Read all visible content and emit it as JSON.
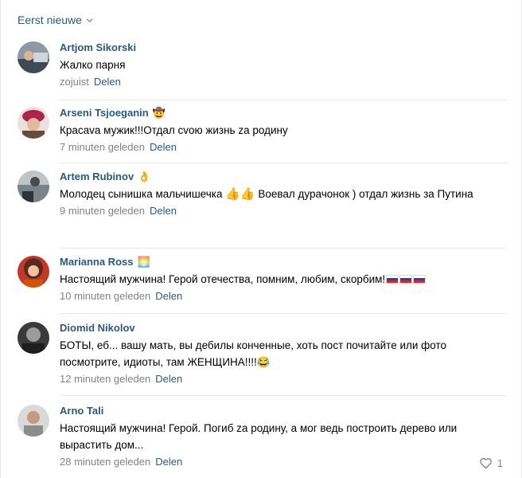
{
  "sort": {
    "label": "Eerst nieuwe"
  },
  "reply_label": "Delen",
  "comments": [
    {
      "author": "Artjom Sikorski",
      "emoji": "",
      "text": "Жалко парня",
      "time": "zojuist"
    },
    {
      "author": "Arseni Tsjoeganin",
      "emoji": "🤠",
      "text": "Красаva мужик!!!Отдал cvою жизнь zа родину",
      "time": "7 minuten geleden"
    },
    {
      "author": "Artem Rubinov",
      "emoji": "👌",
      "text_lines": [
        "Молодец сынишка мальчишечка",
        "👍👍",
        "Воевал дурачонок ) отдал жизнь за Путина"
      ],
      "time": "9 minuten geleden"
    },
    {
      "author": "Marianna Ross",
      "emoji": "🌅",
      "text": "Настоящий мужчина! Герой отечества, помним, любим, скорбим!",
      "time": "10 minuten geleden"
    },
    {
      "author": "Diomid Nikolov",
      "emoji": "",
      "text": "БОТЫ, еб... вашу мать, вы дебилы конченные, хоть пост почитайте или фото посмотрите, идиоты, там ЖЕНЩИНА!!!!",
      "text_emoji": "😂",
      "time": "12 minuten geleden"
    },
    {
      "author": "Arno Tali",
      "emoji": "",
      "text": "Настоящий мужчина! Герой. Погиб zа родину, а мог ведь построить дерево или вырастить дом...",
      "time": "28 minuten geleden",
      "likes": "1"
    }
  ],
  "colors": {
    "link": "#2a5885",
    "meta": "#828282",
    "divider": "#e7e8ec"
  }
}
